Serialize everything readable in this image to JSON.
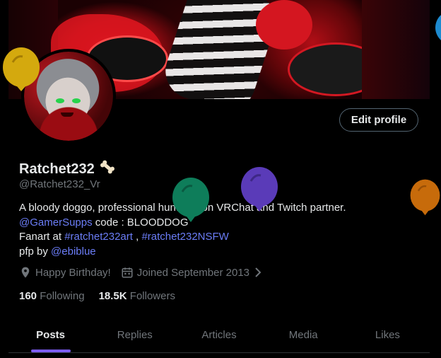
{
  "profile": {
    "display_name": "Ratchet232",
    "name_emoji": "bone-icon",
    "handle": "@Ratchet232_Vr",
    "edit_button_label": "Edit profile",
    "bio": {
      "line1": "A bloody doggo, professional huntress on VRChat and Twitch partner.",
      "line2_link": "@GamerSupps",
      "line2_text": " code : BLOODDOG",
      "line3_text": "Fanart at ",
      "line3_link1": "#ratchet232art",
      "line3_sep": " , ",
      "line3_link2": "#ratchet232NSFW",
      "line4_text": "pfp by ",
      "line4_link": "@ebiblue"
    },
    "meta": {
      "birthday": "Happy Birthday!",
      "joined": "Joined September 2013"
    },
    "following_count": "160",
    "following_label": "Following",
    "followers_count": "18.5K",
    "followers_label": "Followers"
  },
  "tabs": [
    {
      "label": "Posts",
      "active": true
    },
    {
      "label": "Replies",
      "active": false
    },
    {
      "label": "Articles",
      "active": false
    },
    {
      "label": "Media",
      "active": false
    },
    {
      "label": "Likes",
      "active": false
    }
  ],
  "colors": {
    "accent": "#7c5cf4",
    "link": "#6b7df7",
    "balloon_yellow": "#d4a90e",
    "balloon_green": "#0e7d5a",
    "balloon_purple": "#5a3bb8",
    "balloon_orange": "#c76b0b",
    "balloon_blue": "#1d8bd0"
  }
}
